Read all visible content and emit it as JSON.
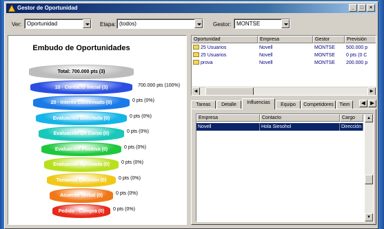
{
  "window": {
    "title": "Gestor de Oportunidad"
  },
  "title_buttons": [
    "_",
    "□",
    "×"
  ],
  "toolbar": {
    "ver_label": "Ver:",
    "ver_value": "Oportunidad",
    "etapa_label": "Etapa:",
    "etapa_value": "(todos)",
    "gestor_label": "Gestor:",
    "gestor_value": "MONTSE"
  },
  "funnel": {
    "title": "Embudo de Oportunidades",
    "stages": [
      {
        "label": "Total: 700.000 pts  (3)",
        "value": "",
        "color": "#bcbcbc"
      },
      {
        "label": "10 · Contacto Inicial  (3)",
        "value": "700.000 pts (100%)",
        "color": "#2a4ee0"
      },
      {
        "label": "20 · Interés Confirmado  (0)",
        "value": "0 pts (0%)",
        "color": "#1a7ae8"
      },
      {
        "label": "Evaluación Solicitada  (0)",
        "value": "0 pts (0%)",
        "color": "#14b4e8"
      },
      {
        "label": "Evaluación En Curso  (0)",
        "value": "0 pts (0%)",
        "color": "#18c8b8"
      },
      {
        "label": "Evaluación Positiva  (0)",
        "value": "0 pts (0%)",
        "color": "#1ec83c"
      },
      {
        "label": "Evaluación Aprobada  (0)",
        "value": "0 pts (0%)",
        "color": "#b8e01e"
      },
      {
        "label": "Tomando Decisión  (0)",
        "value": "0 pts (0%)",
        "color": "#f0c818"
      },
      {
        "label": "Acuerdo Verbal  (0)",
        "value": "0 pts (0%)",
        "color": "#f07818"
      },
      {
        "label": "Pedido · Compra  (0)",
        "value": "0 pts (0%)",
        "color": "#e82a18"
      }
    ]
  },
  "opportunities": {
    "columns": [
      "Oportunidad",
      "Empresa",
      "Gestor",
      "Previsión"
    ],
    "rows": [
      [
        "25 Usuarios",
        "Novell",
        "MONTSE",
        "500.000 p"
      ],
      [
        "25 Usuarios",
        "Novell",
        "MONTSE",
        "0 pts (0 C"
      ],
      [
        "prova",
        "Novell",
        "MONTSE",
        "200.000 p"
      ]
    ]
  },
  "tabs": [
    "Tareas",
    "Detalle",
    "Influencias",
    "Equipo",
    "Competidores",
    "Tiem"
  ],
  "influences": {
    "columns": [
      "Empresa",
      "Contacto",
      "Cargo"
    ],
    "rows": [
      [
        "Novell",
        "Hola Siesohol",
        "Dirección"
      ]
    ]
  }
}
